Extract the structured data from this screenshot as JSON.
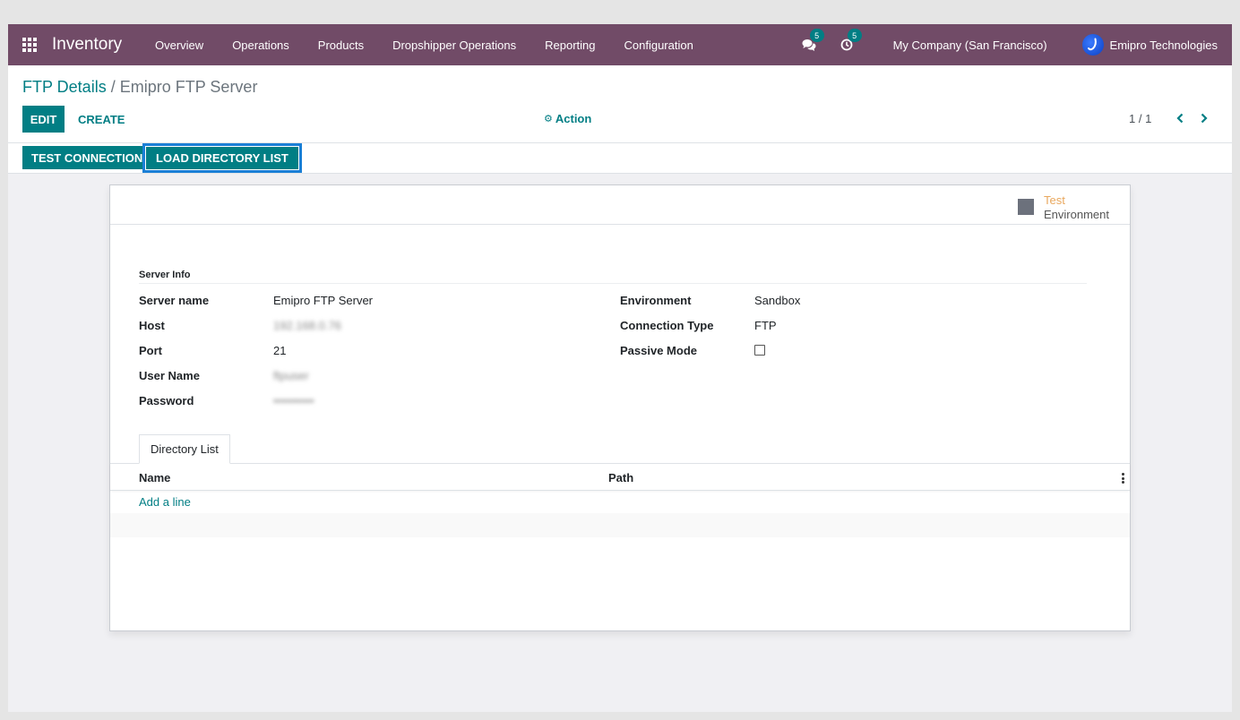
{
  "navbar": {
    "app_name": "Inventory",
    "menu": [
      "Overview",
      "Operations",
      "Products",
      "Dropshipper Operations",
      "Reporting",
      "Configuration"
    ],
    "messages_count": "5",
    "activities_count": "5",
    "company": "My Company (San Francisco)",
    "user_name": "Emipro Technologies",
    "icons": {
      "apps": "apps-grid-icon",
      "messages": "chat-bubbles-icon",
      "activities": "clock-icon"
    }
  },
  "control_panel": {
    "breadcrumb_parent": "FTP Details",
    "breadcrumb_separator": "/",
    "breadcrumb_current": "Emipro FTP Server",
    "edit_label": "EDIT",
    "create_label": "CREATE",
    "action_label": "Action",
    "pager_value": "1 / 1"
  },
  "header_buttons": {
    "test_connection": "TEST CONNECTION",
    "load_directory_list": "LOAD DIRECTORY LIST"
  },
  "sheet": {
    "stat_button": {
      "value": "Test",
      "label": "Environment"
    },
    "group_title": "Server Info",
    "left_fields": [
      {
        "label": "Server name",
        "value": "Emipro FTP Server"
      },
      {
        "label": "Host",
        "value": "192.168.0.76"
      },
      {
        "label": "Port",
        "value": "21"
      },
      {
        "label": "User Name",
        "value": "ftpuser"
      },
      {
        "label": "Password",
        "value": "••••••••••"
      }
    ],
    "right_fields": [
      {
        "label": "Environment",
        "value": "Sandbox"
      },
      {
        "label": "Connection Type",
        "value": "FTP"
      },
      {
        "label": "Passive Mode",
        "value": ""
      }
    ],
    "passive_mode_checked": false,
    "tab_label": "Directory List",
    "list_columns": [
      "Name",
      "Path"
    ],
    "add_line_label": "Add a line"
  },
  "colors": {
    "navbar": "#714b67",
    "primary": "#017e84",
    "focus_ring": "#1a7fd6",
    "stat_value": "#e9a85e"
  }
}
